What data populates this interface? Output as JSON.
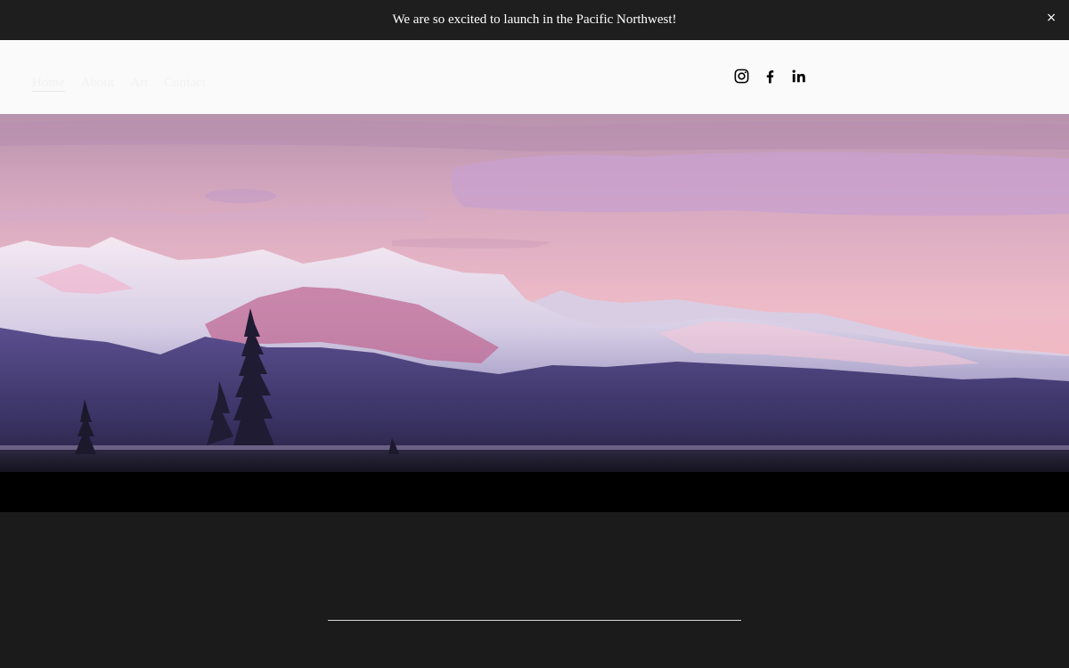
{
  "announcement": {
    "text": "We are so excited to launch in the Pacific Northwest!",
    "close_label": "×"
  },
  "nav": {
    "items": [
      {
        "label": "Home",
        "active": true
      },
      {
        "label": "About",
        "active": false
      },
      {
        "label": "Art",
        "active": false
      },
      {
        "label": "Contact",
        "active": false
      }
    ]
  },
  "social": {
    "icons": [
      "instagram-icon",
      "facebook-icon",
      "linkedin-icon"
    ]
  },
  "hero": {
    "image": "snow-capped-mountain-range-at-sunset"
  },
  "colors": {
    "announcement_bg": "#1e1e1e",
    "header_bg": "#fafafa",
    "footer_bg": "#1b1b1b",
    "sky_top": "#c9a3b8",
    "sky_mid": "#e8b5c4",
    "mountain_shadow": "#4a3f78"
  }
}
